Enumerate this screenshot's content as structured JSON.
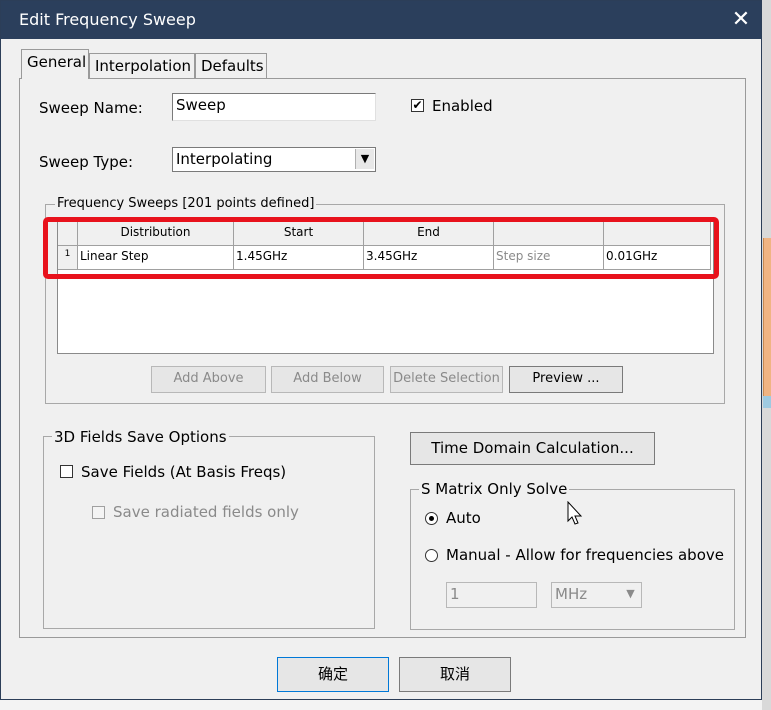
{
  "window": {
    "title": "Edit Frequency Sweep"
  },
  "tabs": [
    {
      "label": "General"
    },
    {
      "label": "Interpolation"
    },
    {
      "label": "Defaults"
    }
  ],
  "general": {
    "sweep_name_label": "Sweep Name:",
    "sweep_name_value": "Sweep",
    "enabled_label": "Enabled",
    "enabled_checked": true,
    "sweep_type_label": "Sweep Type:",
    "sweep_type_value": "Interpolating"
  },
  "frequency_sweeps": {
    "legend": "Frequency Sweeps [201 points defined]",
    "columns": [
      "Distribution",
      "Start",
      "End",
      "",
      ""
    ],
    "rows": [
      {
        "num": "1",
        "distribution": "Linear Step",
        "start": "1.45GHz",
        "end": "3.45GHz",
        "step_label": "Step size",
        "step_value": "0.01GHz"
      }
    ],
    "buttons": {
      "add_above": "Add Above",
      "add_below": "Add Below",
      "delete_selection": "Delete Selection",
      "preview": "Preview ..."
    }
  },
  "fields_save": {
    "legend": "3D Fields Save Options",
    "save_fields_label": "Save Fields (At Basis Freqs)",
    "save_radiated_label": "Save radiated fields only"
  },
  "time_domain": {
    "button": "Time Domain Calculation..."
  },
  "s_matrix": {
    "legend": "S Matrix Only Solve",
    "auto_label": "Auto",
    "manual_label": "Manual -  Allow for frequencies above",
    "manual_value": "1",
    "unit_value": "MHz"
  },
  "footer": {
    "ok": "确定",
    "cancel": "取消"
  },
  "colors": {
    "titlebar": "#2b3f5c",
    "highlight": "#e8121c"
  }
}
